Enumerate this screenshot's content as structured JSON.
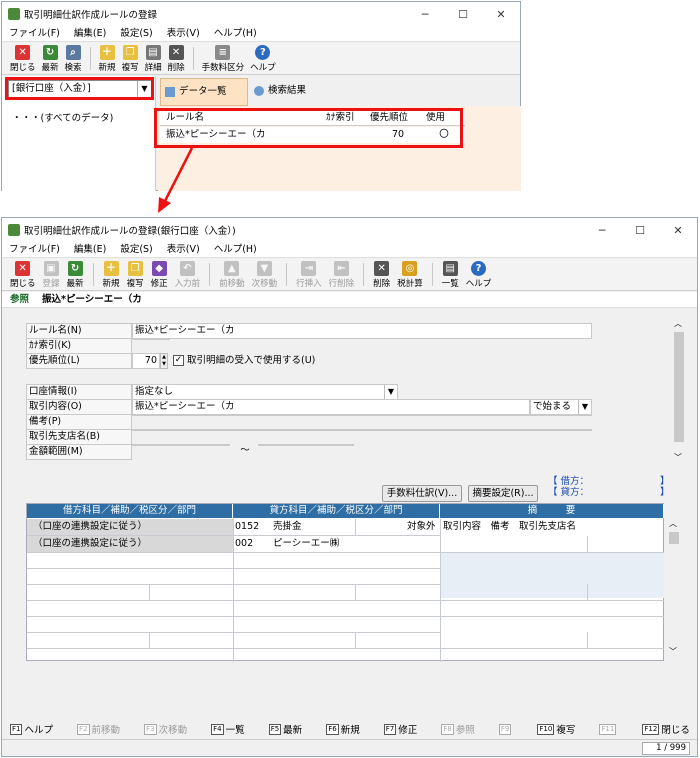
{
  "top": {
    "title": "取引明細仕訳作成ルールの登録",
    "menu": [
      "ファイル(F)",
      "編集(E)",
      "設定(S)",
      "表示(V)",
      "ヘルプ(H)"
    ],
    "toolbar": [
      "閉じる",
      "最新",
      "検索",
      "新規",
      "複写",
      "詳細",
      "削除",
      "手数料区分",
      "ヘルプ"
    ],
    "account_select": "[銀行口座（入金）]",
    "tabs": [
      "データ一覧",
      "検索結果"
    ],
    "tree_item": "・・・(すべてのデータ)",
    "list_headers": [
      "ルール名",
      "ｶﾅ索引",
      "優先順位",
      "使用"
    ],
    "list_row": {
      "rule": "振込*ピーシーエー（カ",
      "kana": "",
      "priority": "70",
      "use": "〇"
    }
  },
  "bottom": {
    "title": "取引明細仕訳作成ルールの登録(銀行口座（入金）)",
    "menu": [
      "ファイル(F)",
      "編集(E)",
      "設定(S)",
      "表示(V)",
      "ヘルプ(H)"
    ],
    "toolbar": [
      {
        "label": "閉じる",
        "enabled": true,
        "color": "#d33"
      },
      {
        "label": "登録",
        "enabled": false,
        "color": "#777"
      },
      {
        "label": "最新",
        "enabled": true,
        "color": "#3a8a3a"
      },
      {
        "label": "新規",
        "enabled": true,
        "color": "#e8c040"
      },
      {
        "label": "複写",
        "enabled": true,
        "color": "#e8c040"
      },
      {
        "label": "修正",
        "enabled": true,
        "color": "#7a4ab0"
      },
      {
        "label": "入力前",
        "enabled": false,
        "color": "#777"
      },
      {
        "label": "前移動",
        "enabled": false,
        "color": "#777"
      },
      {
        "label": "次移動",
        "enabled": false,
        "color": "#777"
      },
      {
        "label": "行挿入",
        "enabled": false,
        "color": "#777"
      },
      {
        "label": "行削除",
        "enabled": false,
        "color": "#777"
      },
      {
        "label": "削除",
        "enabled": true,
        "color": "#555"
      },
      {
        "label": "税計算",
        "enabled": true,
        "color": "#d9a020"
      },
      {
        "label": "一覧",
        "enabled": true,
        "color": "#555"
      },
      {
        "label": "ヘルプ",
        "enabled": true,
        "color": "#2a6ac0"
      }
    ],
    "mode_label": "参照",
    "record_title": "振込*ピーシーエー（カ",
    "form": {
      "rule_name_label": "ルール名(N)",
      "rule_name": "振込*ピーシーエー（カ",
      "kana_label": "ｶﾅ索引(K)",
      "kana": "",
      "priority_label": "優先順位(L)",
      "priority": "70",
      "use_check_label": "取引明細の受入で使用する(U)",
      "account_info_label": "口座情報(I)",
      "account_info": "指定なし",
      "content_label": "取引内容(O)",
      "content": "振込*ピーシーエー（カ",
      "content_match": "で始まる",
      "memo_label": "備考(P)",
      "branch_label": "取引先支店名(B)",
      "amount_label": "金額範囲(M)",
      "amount_sep": "～"
    },
    "fee_button": "手数料仕訳(V)...",
    "summary_button": "摘要設定(R)...",
    "debit_label": "【 借方：",
    "credit_label": "【 貸方：",
    "bracket_end": "】",
    "grid_headers": [
      "借方科目／補助／税区分／部門",
      "貸方科目／補助／税区分／部門",
      "摘　　　要"
    ],
    "grid_rows": [
      {
        "debit": "（口座の連携設定に従う）",
        "credit_code": "0152",
        "credit_name": "売掛金",
        "credit_tax": "対象外",
        "summary": "取引内容　備考　取引先支店名"
      },
      {
        "debit": "（口座の連携設定に従う）",
        "credit_code": "002",
        "credit_name": "ピーシーエー㈱",
        "credit_tax": "",
        "summary": ""
      }
    ],
    "fkeys": [
      {
        "key": "F1",
        "label": "ヘルプ",
        "enabled": true
      },
      {
        "key": "F2",
        "label": "前移動",
        "enabled": false
      },
      {
        "key": "F3",
        "label": "次移動",
        "enabled": false
      },
      {
        "key": "F4",
        "label": "一覧",
        "enabled": true
      },
      {
        "key": "F5",
        "label": "最新",
        "enabled": true
      },
      {
        "key": "F6",
        "label": "新規",
        "enabled": true
      },
      {
        "key": "F7",
        "label": "修正",
        "enabled": true
      },
      {
        "key": "F8",
        "label": "参照",
        "enabled": false
      },
      {
        "key": "F9",
        "label": "",
        "enabled": false
      },
      {
        "key": "F10",
        "label": "複写",
        "enabled": true
      },
      {
        "key": "F11",
        "label": "",
        "enabled": false
      },
      {
        "key": "F12",
        "label": "閉じる",
        "enabled": true
      }
    ],
    "page_indicator": "1 / 999"
  }
}
